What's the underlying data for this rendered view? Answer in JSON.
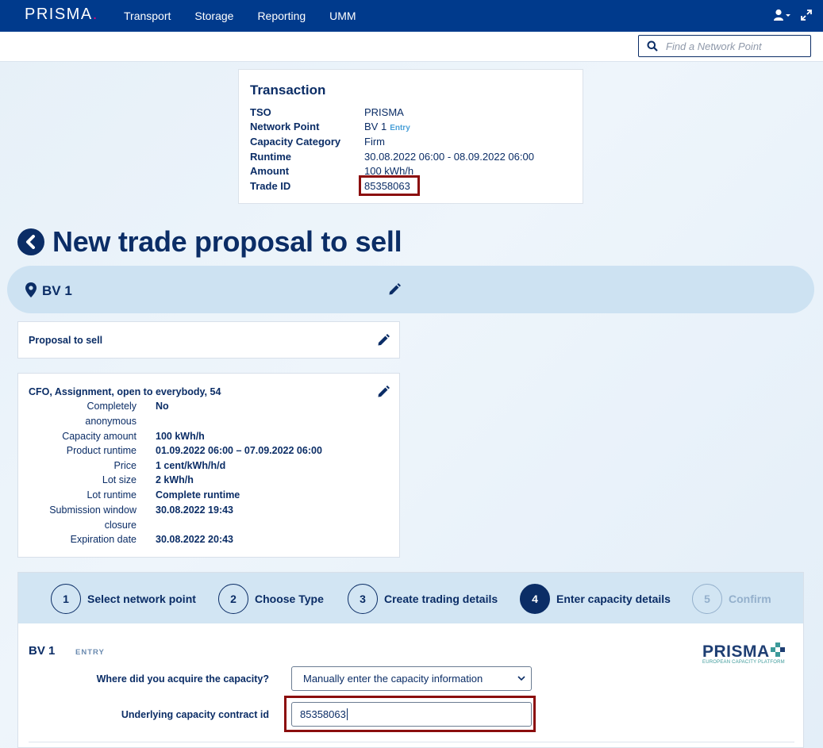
{
  "app": {
    "logo": "PRISMA",
    "logo_dot": ".",
    "nav": [
      "Transport",
      "Storage",
      "Reporting",
      "UMM"
    ],
    "search_placeholder": "Find a Network Point"
  },
  "transaction": {
    "title": "Transaction",
    "rows": [
      {
        "key": "TSO",
        "value": "PRISMA"
      },
      {
        "key": "Network Point",
        "value": "BV 1",
        "tag": "Entry"
      },
      {
        "key": "Capacity Category",
        "value": "Firm"
      },
      {
        "key": "Runtime",
        "value": "30.08.2022 06:00 - 08.09.2022 06:00"
      },
      {
        "key": "Amount",
        "value": "100 kWh/h"
      },
      {
        "key": "Trade ID",
        "value": "85358063"
      }
    ]
  },
  "page_title": "New trade proposal to sell",
  "network_point": "BV 1",
  "proposal_label": "Proposal to sell",
  "details": {
    "heading": "CFO, Assignment, open to everybody, 54",
    "rows": [
      {
        "key": "Completely anonymous",
        "value": "No"
      },
      {
        "key": "Capacity amount",
        "value": "100 kWh/h"
      },
      {
        "key": "Product runtime",
        "value": "01.09.2022 06:00 – 07.09.2022 06:00"
      },
      {
        "key": "Price",
        "value": "1 cent/kWh/h/d"
      },
      {
        "key": "Lot size",
        "value": "2 kWh/h"
      },
      {
        "key": "Lot runtime",
        "value": "Complete runtime"
      },
      {
        "key": "Submission window closure",
        "value": "30.08.2022 19:43"
      },
      {
        "key": "Expiration date",
        "value": "30.08.2022 20:43"
      }
    ]
  },
  "steps": [
    {
      "num": "1",
      "label": "Select network point",
      "state": "done"
    },
    {
      "num": "2",
      "label": "Choose Type",
      "state": "done"
    },
    {
      "num": "3",
      "label": "Create trading details",
      "state": "done"
    },
    {
      "num": "4",
      "label": "Enter capacity details",
      "state": "active"
    },
    {
      "num": "5",
      "label": "Confirm",
      "state": "disabled"
    }
  ],
  "form": {
    "bv_title": "BV 1",
    "bv_tag": "ENTRY",
    "brand_word": "PRISMA",
    "brand_sub": "EUROPEAN CAPACITY PLATFORM",
    "acquire_label": "Where did you acquire the capacity?",
    "acquire_value": "Manually enter the capacity information",
    "contract_label": "Underlying capacity contract id",
    "contract_value": "85358063"
  },
  "colors": {
    "brand_navy": "#003a8c",
    "text_navy": "#0b2d66",
    "highlight": "#8b0d0d",
    "accent_pink": "#e4007c"
  }
}
